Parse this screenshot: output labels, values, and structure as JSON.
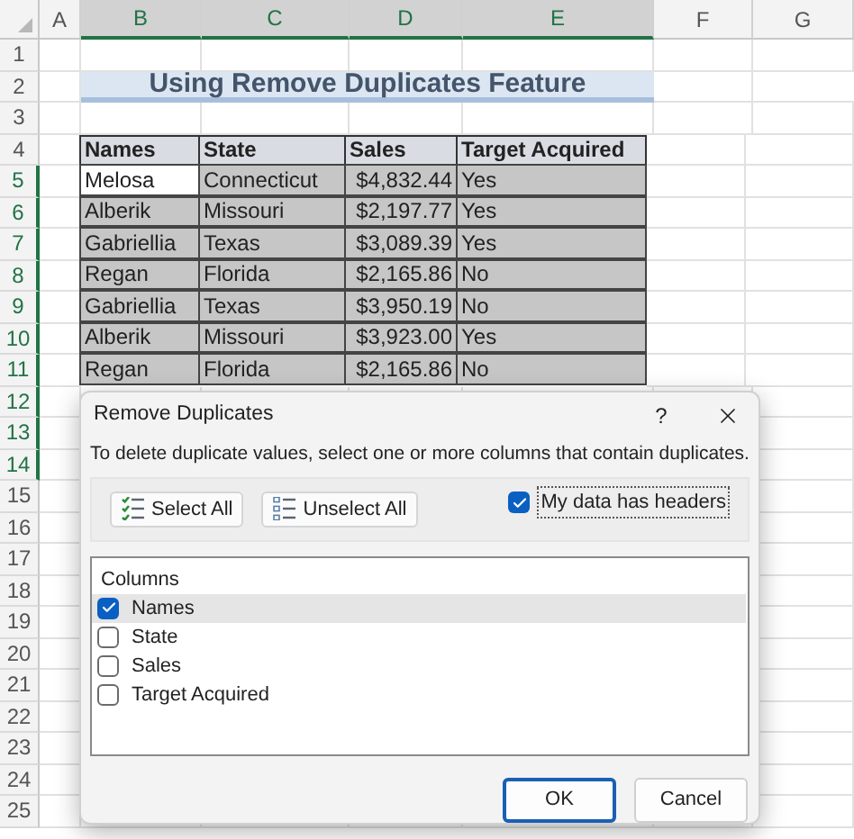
{
  "column_headers": [
    {
      "label": "A",
      "selected": false
    },
    {
      "label": "B",
      "selected": true
    },
    {
      "label": "C",
      "selected": true
    },
    {
      "label": "D",
      "selected": true
    },
    {
      "label": "E",
      "selected": true
    },
    {
      "label": "F",
      "selected": false
    },
    {
      "label": "G",
      "selected": false
    }
  ],
  "row_numbers": [
    {
      "label": "1",
      "selected": false
    },
    {
      "label": "2",
      "selected": false
    },
    {
      "label": "3",
      "selected": false
    },
    {
      "label": "4",
      "selected": false
    },
    {
      "label": "5",
      "selected": true
    },
    {
      "label": "6",
      "selected": true
    },
    {
      "label": "7",
      "selected": true
    },
    {
      "label": "8",
      "selected": true
    },
    {
      "label": "9",
      "selected": true
    },
    {
      "label": "10",
      "selected": true
    },
    {
      "label": "11",
      "selected": true
    },
    {
      "label": "12",
      "selected": true
    },
    {
      "label": "13",
      "selected": true
    },
    {
      "label": "14",
      "selected": true
    },
    {
      "label": "15",
      "selected": false
    },
    {
      "label": "16",
      "selected": false
    },
    {
      "label": "17",
      "selected": false
    },
    {
      "label": "18",
      "selected": false
    },
    {
      "label": "19",
      "selected": false
    },
    {
      "label": "20",
      "selected": false
    },
    {
      "label": "21",
      "selected": false
    },
    {
      "label": "22",
      "selected": false
    },
    {
      "label": "23",
      "selected": false
    },
    {
      "label": "24",
      "selected": false
    },
    {
      "label": "25",
      "selected": false
    }
  ],
  "sheet_title": "Using Remove Duplicates Feature",
  "table": {
    "columns": [
      "Names",
      "State",
      "Sales",
      "Target Acquired"
    ],
    "rows": [
      {
        "cells": [
          "Melosa",
          "Connecticut",
          "$4,832.44",
          "Yes"
        ],
        "active": true
      },
      {
        "cells": [
          "Alberik",
          "Missouri",
          "$2,197.77",
          "Yes"
        ],
        "active": false
      },
      {
        "cells": [
          "Gabriellia",
          "Texas",
          "$3,089.39",
          "Yes"
        ],
        "active": false
      },
      {
        "cells": [
          "Regan",
          "Florida",
          "$2,165.86",
          "No"
        ],
        "active": false
      },
      {
        "cells": [
          "Gabriellia",
          "Texas",
          "$3,950.19",
          "No"
        ],
        "active": false
      },
      {
        "cells": [
          "Alberik",
          "Missouri",
          "$3,923.00",
          "Yes"
        ],
        "active": false
      },
      {
        "cells": [
          "Regan",
          "Florida",
          "$2,165.86",
          "No"
        ],
        "active": false
      }
    ]
  },
  "dialog": {
    "title": "Remove Duplicates",
    "help": "?",
    "instruction": "To delete duplicate values, select one or more columns that contain duplicates.",
    "select_all": "Select All",
    "unselect_all": "Unselect All",
    "headers_option": {
      "label": "My data has headers",
      "checked": true
    },
    "columns_label": "Columns",
    "columns": [
      {
        "label": "Names",
        "checked": true,
        "selected": true
      },
      {
        "label": "State",
        "checked": false,
        "selected": false
      },
      {
        "label": "Sales",
        "checked": false,
        "selected": false
      },
      {
        "label": "Target Acquired",
        "checked": false,
        "selected": false
      }
    ],
    "buttons": [
      "OK",
      "Cancel"
    ]
  }
}
